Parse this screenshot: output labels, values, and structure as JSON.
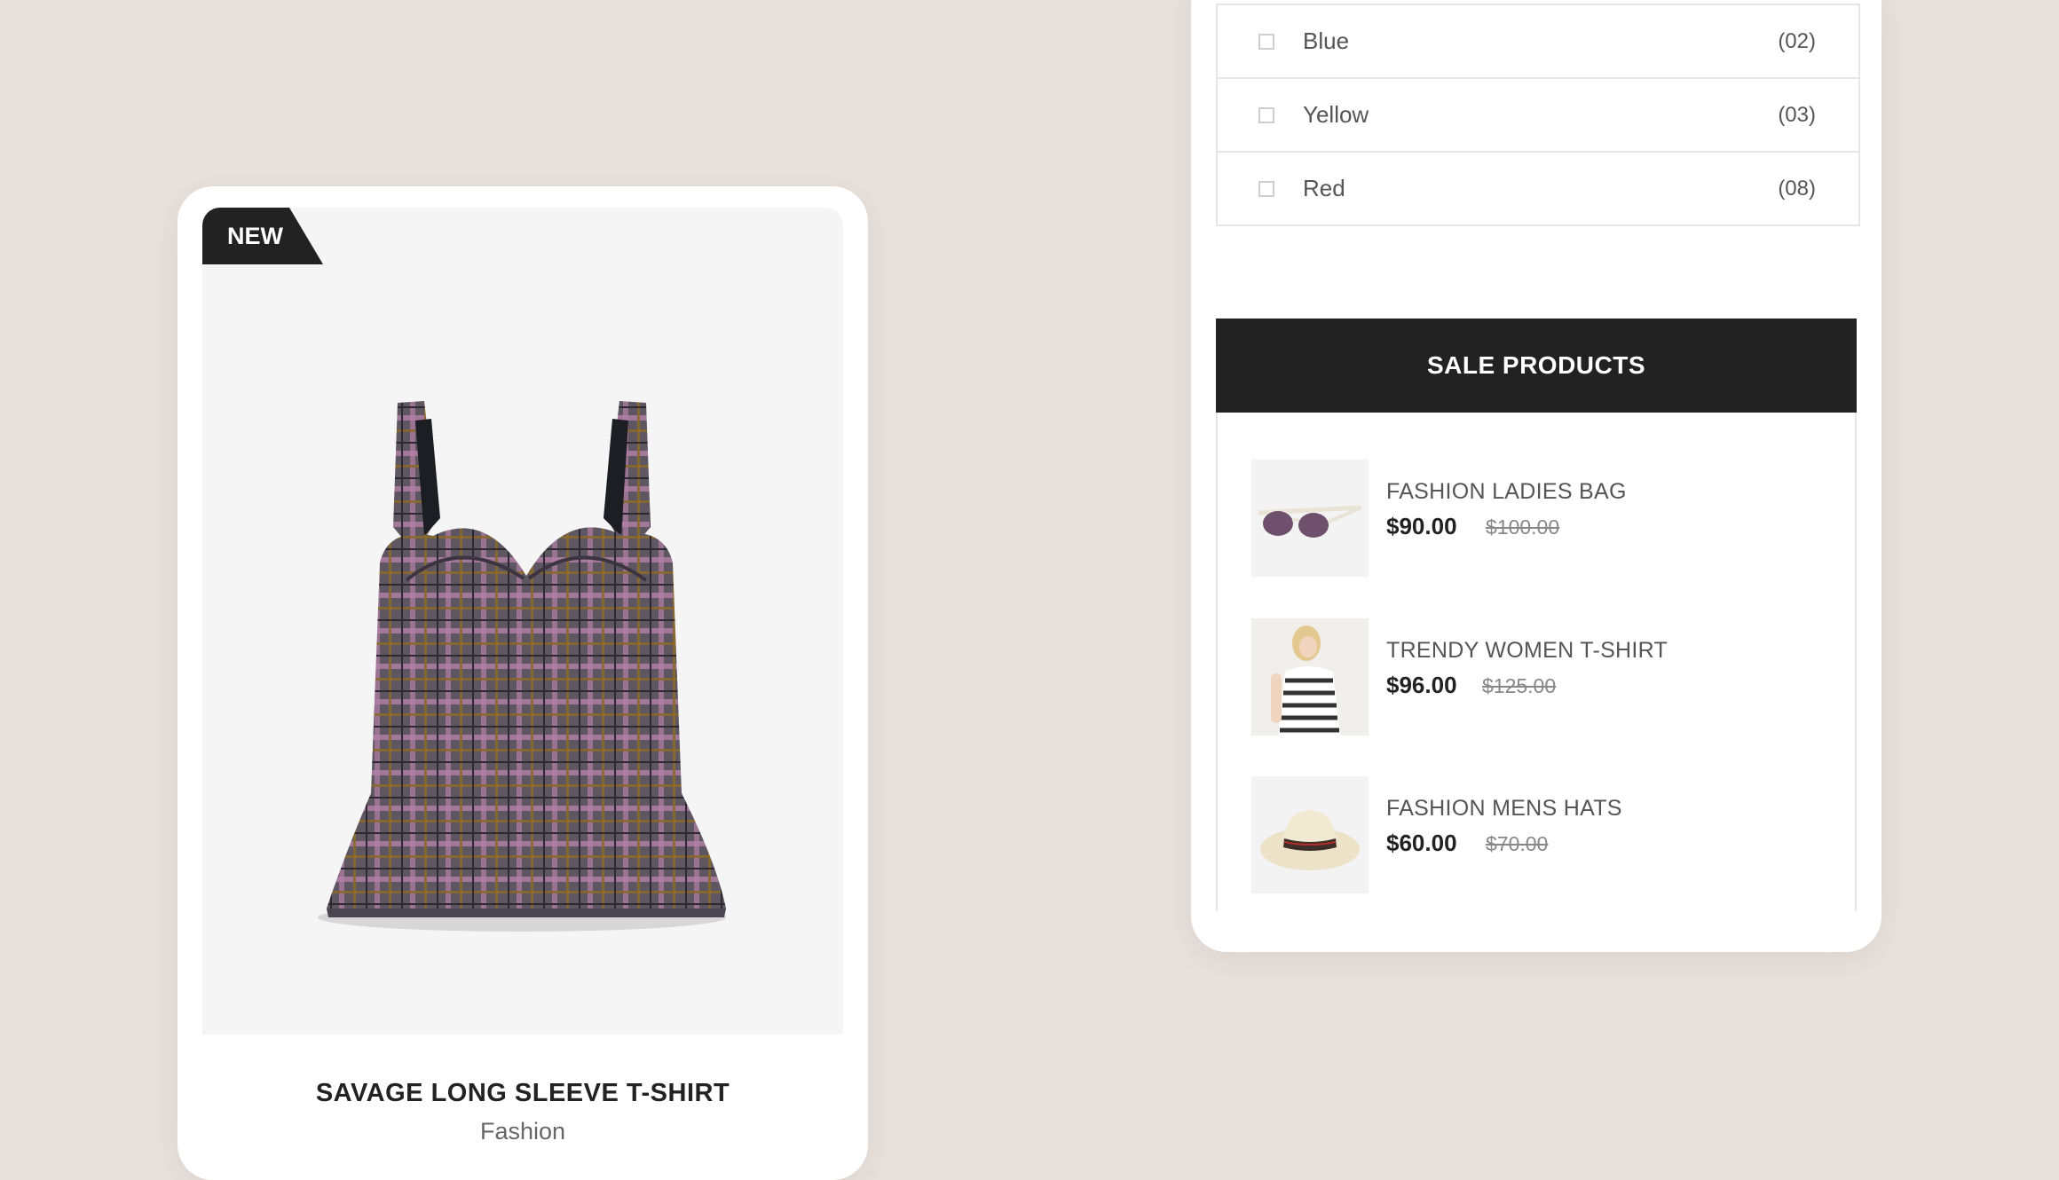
{
  "product_card": {
    "badge": "NEW",
    "title": "SAVAGE LONG SLEEVE T-SHIRT",
    "category": "Fashion",
    "image_icon": "plaid-bustier-top-image"
  },
  "color_filter": {
    "items": [
      {
        "label": "Blue",
        "count": "(02)"
      },
      {
        "label": "Yellow",
        "count": "(03)"
      },
      {
        "label": "Red",
        "count": "(08)"
      }
    ]
  },
  "sale_products": {
    "heading": "SALE PRODUCTS",
    "items": [
      {
        "name": "FASHION LADIES BAG",
        "price": "$90.00",
        "old_price": "$100.00",
        "thumb": "sunglasses-image"
      },
      {
        "name": "TRENDY WOMEN T-SHIRT",
        "price": "$96.00",
        "old_price": "$125.00",
        "thumb": "woman-striped-top-image"
      },
      {
        "name": "FASHION MENS HATS",
        "price": "$60.00",
        "old_price": "$70.00",
        "thumb": "straw-hat-image"
      }
    ]
  },
  "colors": {
    "page_bg": "#e8e0da",
    "card_bg": "#ffffff",
    "dark": "#222222",
    "image_bg": "#f5f5f5"
  }
}
